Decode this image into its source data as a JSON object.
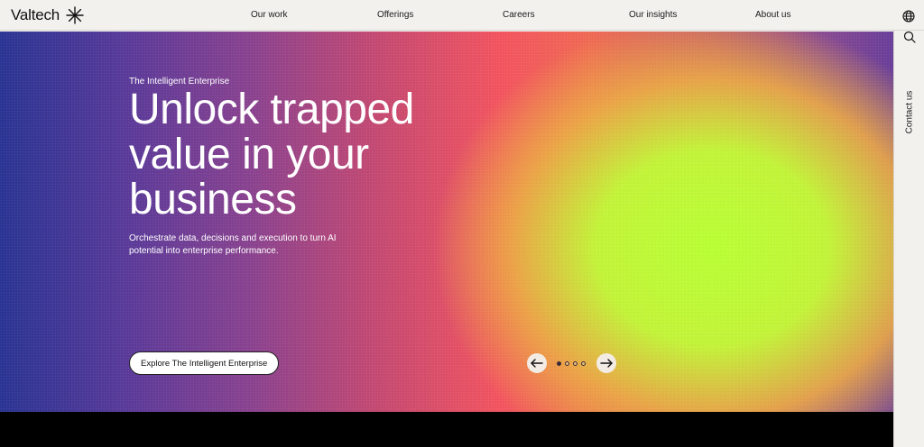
{
  "brand": {
    "name": "Valtech"
  },
  "nav": {
    "items": [
      {
        "label": "Our work"
      },
      {
        "label": "Offerings"
      },
      {
        "label": "Careers"
      },
      {
        "label": "Our insights"
      },
      {
        "label": "About us"
      }
    ]
  },
  "header_icons": {
    "language": "globe-icon"
  },
  "sidebar": {
    "search_icon": "search-icon",
    "contact_label": "Contact us"
  },
  "hero": {
    "eyebrow": "The Intelligent Enterprise",
    "headline_lines": [
      "Unlock trapped",
      "value in your",
      "business"
    ],
    "subtext": "Orchestrate data, decisions and execution to turn AI potential into enterprise performance.",
    "cta_label": "Explore The Intelligent Enterprise",
    "carousel": {
      "slide_count": 4,
      "active_index": 0,
      "prev_icon": "arrow-left-icon",
      "next_icon": "arrow-right-icon"
    }
  },
  "colors": {
    "header_bg": "#f2f1ee",
    "text": "#111111",
    "hero_blue": "#2b3594",
    "hero_red": "#f35560",
    "hero_green": "#b9ff35"
  }
}
